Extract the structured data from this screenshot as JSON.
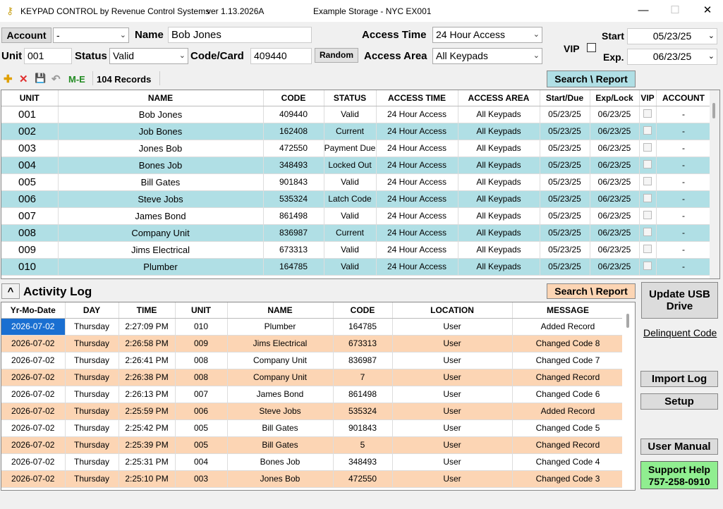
{
  "window": {
    "title": "KEYPAD CONTROL by Revenue Control Systems",
    "version": "ver 1.13.2026A",
    "site": "Example Storage - NYC   EX001",
    "minimize": "—",
    "maximize": "☐",
    "close": "✕"
  },
  "form": {
    "account_label": "Account",
    "account_value": "-",
    "name_label": "Name",
    "name_value": "Bob Jones",
    "access_time_label": "Access Time",
    "access_time_value": "24 Hour Access",
    "start_label": "Start",
    "start_value": "05/23/25",
    "unit_label": "Unit",
    "unit_value": "001",
    "status_label": "Status",
    "status_value": "Valid",
    "code_label": "Code/Card",
    "code_value": "409440",
    "random_label": "Random",
    "access_area_label": "Access Area",
    "access_area_value": "All Keypads",
    "vip_label": "VIP",
    "exp_label": "Exp.",
    "exp_value": "06/23/25"
  },
  "toolbar": {
    "add": "✚",
    "delete": "✕",
    "save": "💾",
    "undo": "↶",
    "me": "M-E",
    "records": "104 Records",
    "search_report": "Search \\ Report"
  },
  "units_table": {
    "headers": [
      "UNIT",
      "NAME",
      "CODE",
      "STATUS",
      "ACCESS TIME",
      "ACCESS AREA",
      "Start/Due",
      "Exp/Lock",
      "VIP",
      "ACCOUNT"
    ],
    "rows": [
      [
        "001",
        "Bob Jones",
        "409440",
        "Valid",
        "24 Hour Access",
        "All Keypads",
        "05/23/25",
        "06/23/25",
        "",
        "-"
      ],
      [
        "002",
        "Job Bones",
        "162408",
        "Current",
        "24 Hour Access",
        "All Keypads",
        "05/23/25",
        "06/23/25",
        "",
        "-"
      ],
      [
        "003",
        "Jones Bob",
        "472550",
        "Payment Due",
        "24 Hour Access",
        "All Keypads",
        "05/23/25",
        "06/23/25",
        "",
        "-"
      ],
      [
        "004",
        "Bones Job",
        "348493",
        "Locked Out",
        "24 Hour Access",
        "All Keypads",
        "05/23/25",
        "06/23/25",
        "",
        "-"
      ],
      [
        "005",
        "Bill Gates",
        "901843",
        "Valid",
        "24 Hour Access",
        "All Keypads",
        "05/23/25",
        "06/23/25",
        "",
        "-"
      ],
      [
        "006",
        "Steve Jobs",
        "535324",
        "Latch Code",
        "24 Hour Access",
        "All Keypads",
        "05/23/25",
        "06/23/25",
        "",
        "-"
      ],
      [
        "007",
        "James Bond",
        "861498",
        "Valid",
        "24 Hour Access",
        "All Keypads",
        "05/23/25",
        "06/23/25",
        "",
        "-"
      ],
      [
        "008",
        "Company Unit",
        "836987",
        "Current",
        "24 Hour Access",
        "All Keypads",
        "05/23/25",
        "06/23/25",
        "",
        "-"
      ],
      [
        "009",
        "Jims Electrical",
        "673313",
        "Valid",
        "24 Hour Access",
        "All Keypads",
        "05/23/25",
        "06/23/25",
        "",
        "-"
      ],
      [
        "010",
        "Plumber",
        "164785",
        "Valid",
        "24 Hour Access",
        "All Keypads",
        "05/23/25",
        "06/23/25",
        "",
        "-"
      ]
    ]
  },
  "activity": {
    "toggle": "^",
    "title": "Activity Log",
    "search_report": "Search \\ Report",
    "headers": [
      "Yr-Mo-Date",
      "DAY",
      "TIME",
      "UNIT",
      "NAME",
      "CODE",
      "LOCATION",
      "MESSAGE"
    ],
    "rows": [
      [
        "2026-07-02",
        "Thursday",
        "2:27:09 PM",
        "010",
        "Plumber",
        "164785",
        "User",
        "Added Record"
      ],
      [
        "2026-07-02",
        "Thursday",
        "2:26:58 PM",
        "009",
        "Jims Electrical",
        "673313",
        "User",
        "Changed Code 8"
      ],
      [
        "2026-07-02",
        "Thursday",
        "2:26:41 PM",
        "008",
        "Company Unit",
        "836987",
        "User",
        "Changed Code 7"
      ],
      [
        "2026-07-02",
        "Thursday",
        "2:26:38 PM",
        "008",
        "Company Unit",
        "7",
        "User",
        "Changed Record"
      ],
      [
        "2026-07-02",
        "Thursday",
        "2:26:13 PM",
        "007",
        "James Bond",
        "861498",
        "User",
        "Changed Code 6"
      ],
      [
        "2026-07-02",
        "Thursday",
        "2:25:59 PM",
        "006",
        "Steve Jobs",
        "535324",
        "User",
        "Added Record"
      ],
      [
        "2026-07-02",
        "Thursday",
        "2:25:42 PM",
        "005",
        "Bill Gates",
        "901843",
        "User",
        "Changed Code 5"
      ],
      [
        "2026-07-02",
        "Thursday",
        "2:25:39 PM",
        "005",
        "Bill Gates",
        "5",
        "User",
        "Changed Record"
      ],
      [
        "2026-07-02",
        "Thursday",
        "2:25:31 PM",
        "004",
        "Bones Job",
        "348493",
        "User",
        "Changed Code 4"
      ],
      [
        "2026-07-02",
        "Thursday",
        "2:25:10 PM",
        "003",
        "Jones Bob",
        "472550",
        "User",
        "Changed Code 3"
      ]
    ]
  },
  "side": {
    "update_usb": "Update USB Drive",
    "delinquent": "Delinquent Code",
    "import_log": "Import Log",
    "setup": "Setup",
    "user_manual": "User Manual",
    "support_line1": "Support Help",
    "support_line2": "757-258-0910"
  },
  "colors": {
    "row_alt": "#b0dfe5",
    "log_alt": "#fcd5b4",
    "search_btn": "#b0dfe5",
    "log_search_btn": "#fcd5b4",
    "support": "#90ee90",
    "selected": "#1a6fd1"
  }
}
